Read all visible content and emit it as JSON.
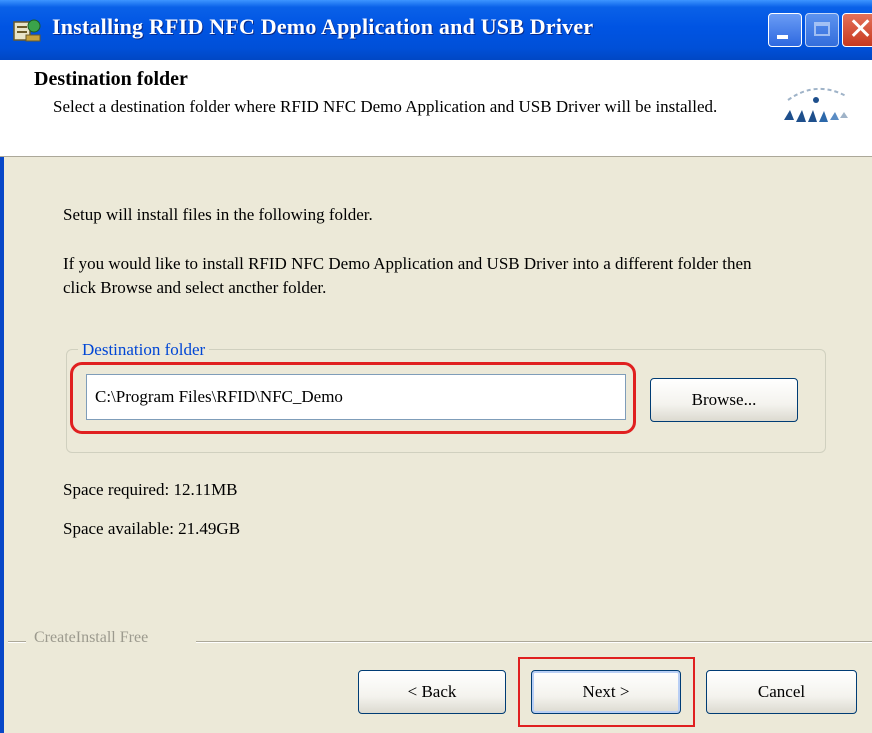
{
  "window": {
    "title": "Installing RFID NFC Demo Application and USB Driver",
    "controls": {
      "minimize": "_",
      "maximize": "□",
      "close": "✕"
    }
  },
  "header": {
    "title": "Destination folder",
    "description": "Select a destination folder where RFID NFC Demo Application and USB Driver will be installed."
  },
  "body": {
    "intro": "Setup will install files in the following folder.",
    "instructions": "If you would like to install RFID NFC Demo Application and USB Driver into a different folder then click Browse and select ancther folder.",
    "group_label": "Destination folder",
    "path_value": "C:\\Program Files\\RFID\\NFC_Demo",
    "browse_label": "Browse...",
    "space_required": "Space required: 12.11MB",
    "space_available": "Space available: 21.49GB"
  },
  "footer": {
    "brand": "CreateInstall Free",
    "back_label": "< Back",
    "next_label": "Next >",
    "cancel_label": "Cancel"
  },
  "colors": {
    "title_bar": "#0054e3",
    "dialog_bg": "#ece9d8",
    "highlight": "#e02020",
    "group_label": "#0046d5"
  }
}
